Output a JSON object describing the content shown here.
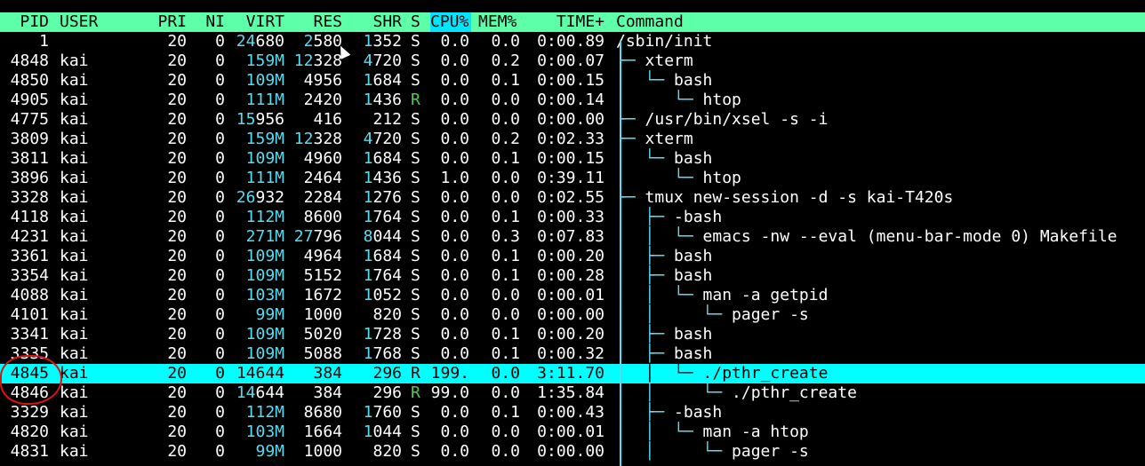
{
  "header": {
    "pid": "PID",
    "user": "USER",
    "pri": "PRI",
    "ni": "NI",
    "virt": "VIRT",
    "res": "RES",
    "shr": "SHR",
    "s": "S",
    "cpu": "CPU%",
    "mem": "MEM%",
    "time": "TIME+",
    "command": "Command"
  },
  "colors": {
    "header_bg": "#5dffa9",
    "sorted_column_bg": "#00e6ff",
    "selected_row_bg": "#00ffff",
    "tree_lines": "#58ddf0",
    "running_state": "#4ec94e",
    "annotation_circle": "#dd1111"
  },
  "processes": [
    {
      "pid": "1",
      "user": "",
      "pri": "20",
      "ni": "0",
      "virt_hi": "24",
      "virt_lo": "680",
      "res_hi": "2",
      "res_lo": "580",
      "shr_hi": "1",
      "shr_lo": "352",
      "s": "S",
      "cpu": "0.0",
      "mem": "0.0",
      "time": "0:00.89",
      "tree": "",
      "cmd": "/sbin/init"
    },
    {
      "pid": "4848",
      "user": "kai",
      "pri": "20",
      "ni": "0",
      "virt_hi": "159M",
      "virt_lo": "",
      "res_hi": "12",
      "res_lo": "328",
      "shr_hi": "4",
      "shr_lo": "720",
      "s": "S",
      "cpu": "0.0",
      "mem": "0.2",
      "time": "0:00.07",
      "tree": "├─ ",
      "cmd": "xterm"
    },
    {
      "pid": "4850",
      "user": "kai",
      "pri": "20",
      "ni": "0",
      "virt_hi": "109M",
      "virt_lo": "",
      "res_hi": "",
      "res_lo": "4956",
      "shr_hi": "1",
      "shr_lo": "684",
      "s": "S",
      "cpu": "0.0",
      "mem": "0.1",
      "time": "0:00.15",
      "tree": "│  └─ ",
      "cmd": "bash"
    },
    {
      "pid": "4905",
      "user": "kai",
      "pri": "20",
      "ni": "0",
      "virt_hi": "111M",
      "virt_lo": "",
      "res_hi": "",
      "res_lo": "2420",
      "shr_hi": "1",
      "shr_lo": "436",
      "s": "R",
      "cpu": "0.0",
      "mem": "0.0",
      "time": "0:00.14",
      "tree": "│     └─ ",
      "cmd": "htop"
    },
    {
      "pid": "4775",
      "user": "kai",
      "pri": "20",
      "ni": "0",
      "virt_hi": "15",
      "virt_lo": "956",
      "res_hi": "",
      "res_lo": "416",
      "shr_hi": "",
      "shr_lo": "212",
      "s": "S",
      "cpu": "0.0",
      "mem": "0.0",
      "time": "0:00.00",
      "tree": "├─ ",
      "cmd": "/usr/bin/xsel -s -i"
    },
    {
      "pid": "3809",
      "user": "kai",
      "pri": "20",
      "ni": "0",
      "virt_hi": "159M",
      "virt_lo": "",
      "res_hi": "12",
      "res_lo": "328",
      "shr_hi": "4",
      "shr_lo": "720",
      "s": "S",
      "cpu": "0.0",
      "mem": "0.2",
      "time": "0:02.33",
      "tree": "├─ ",
      "cmd": "xterm"
    },
    {
      "pid": "3811",
      "user": "kai",
      "pri": "20",
      "ni": "0",
      "virt_hi": "109M",
      "virt_lo": "",
      "res_hi": "",
      "res_lo": "4960",
      "shr_hi": "1",
      "shr_lo": "684",
      "s": "S",
      "cpu": "0.0",
      "mem": "0.1",
      "time": "0:00.15",
      "tree": "│  └─ ",
      "cmd": "bash"
    },
    {
      "pid": "3896",
      "user": "kai",
      "pri": "20",
      "ni": "0",
      "virt_hi": "111M",
      "virt_lo": "",
      "res_hi": "",
      "res_lo": "2464",
      "shr_hi": "1",
      "shr_lo": "436",
      "s": "S",
      "cpu": "1.0",
      "mem": "0.0",
      "time": "0:39.11",
      "tree": "│     └─ ",
      "cmd": "htop"
    },
    {
      "pid": "3328",
      "user": "kai",
      "pri": "20",
      "ni": "0",
      "virt_hi": "26",
      "virt_lo": "932",
      "res_hi": "",
      "res_lo": "2284",
      "shr_hi": "1",
      "shr_lo": "276",
      "s": "S",
      "cpu": "0.0",
      "mem": "0.0",
      "time": "0:02.55",
      "tree": "├─ ",
      "cmd": "tmux new-session -d -s kai-T420s"
    },
    {
      "pid": "4118",
      "user": "kai",
      "pri": "20",
      "ni": "0",
      "virt_hi": "112M",
      "virt_lo": "",
      "res_hi": "",
      "res_lo": "8600",
      "shr_hi": "1",
      "shr_lo": "764",
      "s": "S",
      "cpu": "0.0",
      "mem": "0.1",
      "time": "0:00.33",
      "tree": "│  ├─ ",
      "cmd": "-bash"
    },
    {
      "pid": "4231",
      "user": "kai",
      "pri": "20",
      "ni": "0",
      "virt_hi": "271M",
      "virt_lo": "",
      "res_hi": "27",
      "res_lo": "796",
      "shr_hi": "8",
      "shr_lo": "044",
      "s": "S",
      "cpu": "0.0",
      "mem": "0.3",
      "time": "0:07.83",
      "tree": "│  │  └─ ",
      "cmd": "emacs -nw --eval (menu-bar-mode 0) Makefile"
    },
    {
      "pid": "3361",
      "user": "kai",
      "pri": "20",
      "ni": "0",
      "virt_hi": "109M",
      "virt_lo": "",
      "res_hi": "",
      "res_lo": "4964",
      "shr_hi": "1",
      "shr_lo": "684",
      "s": "S",
      "cpu": "0.0",
      "mem": "0.1",
      "time": "0:00.20",
      "tree": "│  ├─ ",
      "cmd": "bash"
    },
    {
      "pid": "3354",
      "user": "kai",
      "pri": "20",
      "ni": "0",
      "virt_hi": "109M",
      "virt_lo": "",
      "res_hi": "",
      "res_lo": "5152",
      "shr_hi": "1",
      "shr_lo": "764",
      "s": "S",
      "cpu": "0.0",
      "mem": "0.1",
      "time": "0:00.28",
      "tree": "│  ├─ ",
      "cmd": "bash"
    },
    {
      "pid": "4088",
      "user": "kai",
      "pri": "20",
      "ni": "0",
      "virt_hi": "103M",
      "virt_lo": "",
      "res_hi": "",
      "res_lo": "1672",
      "shr_hi": "1",
      "shr_lo": "052",
      "s": "S",
      "cpu": "0.0",
      "mem": "0.0",
      "time": "0:00.01",
      "tree": "│  │  └─ ",
      "cmd": "man -a getpid"
    },
    {
      "pid": "4101",
      "user": "kai",
      "pri": "20",
      "ni": "0",
      "virt_hi": "99M",
      "virt_lo": "",
      "res_hi": "",
      "res_lo": "1000",
      "shr_hi": "",
      "shr_lo": "820",
      "s": "S",
      "cpu": "0.0",
      "mem": "0.0",
      "time": "0:00.00",
      "tree": "│  │     └─ ",
      "cmd": "pager -s"
    },
    {
      "pid": "3341",
      "user": "kai",
      "pri": "20",
      "ni": "0",
      "virt_hi": "109M",
      "virt_lo": "",
      "res_hi": "",
      "res_lo": "5020",
      "shr_hi": "1",
      "shr_lo": "728",
      "s": "S",
      "cpu": "0.0",
      "mem": "0.1",
      "time": "0:00.20",
      "tree": "│  ├─ ",
      "cmd": "bash"
    },
    {
      "pid": "3335",
      "user": "kai",
      "pri": "20",
      "ni": "0",
      "virt_hi": "109M",
      "virt_lo": "",
      "res_hi": "",
      "res_lo": "5088",
      "shr_hi": "1",
      "shr_lo": "768",
      "s": "S",
      "cpu": "0.0",
      "mem": "0.1",
      "time": "0:00.32",
      "tree": "│  ├─ ",
      "cmd": "bash"
    },
    {
      "pid": "4845",
      "user": "kai",
      "pri": "20",
      "ni": "0",
      "virt_hi": "",
      "virt_lo": "14644",
      "res_hi": "",
      "res_lo": "384",
      "shr_hi": "",
      "shr_lo": "296",
      "s": "R",
      "cpu": "199.",
      "mem": "0.0",
      "time": "3:11.70",
      "tree": "│  │  └─ ",
      "cmd": "./pthr_create",
      "selected": true
    },
    {
      "pid": "4846",
      "user": "kai",
      "pri": "20",
      "ni": "0",
      "virt_hi": "14",
      "virt_lo": "644",
      "res_hi": "",
      "res_lo": "384",
      "shr_hi": "",
      "shr_lo": "296",
      "s": "R",
      "cpu": "99.0",
      "mem": "0.0",
      "time": "1:35.84",
      "tree": "│  │     └─ ",
      "cmd": "./pthr_create"
    },
    {
      "pid": "3329",
      "user": "kai",
      "pri": "20",
      "ni": "0",
      "virt_hi": "112M",
      "virt_lo": "",
      "res_hi": "",
      "res_lo": "8680",
      "shr_hi": "1",
      "shr_lo": "760",
      "s": "S",
      "cpu": "0.0",
      "mem": "0.1",
      "time": "0:00.43",
      "tree": "│  ├─ ",
      "cmd": "-bash"
    },
    {
      "pid": "4820",
      "user": "kai",
      "pri": "20",
      "ni": "0",
      "virt_hi": "103M",
      "virt_lo": "",
      "res_hi": "",
      "res_lo": "1664",
      "shr_hi": "1",
      "shr_lo": "044",
      "s": "S",
      "cpu": "0.0",
      "mem": "0.0",
      "time": "0:00.01",
      "tree": "│  │  └─ ",
      "cmd": "man -a htop"
    },
    {
      "pid": "4831",
      "user": "kai",
      "pri": "20",
      "ni": "0",
      "virt_hi": "99M",
      "virt_lo": "",
      "res_hi": "",
      "res_lo": "1000",
      "shr_hi": "",
      "shr_lo": "820",
      "s": "S",
      "cpu": "0.0",
      "mem": "0.0",
      "time": "0:00.00",
      "tree": "│  │     └─ ",
      "cmd": "pager -s"
    }
  ]
}
